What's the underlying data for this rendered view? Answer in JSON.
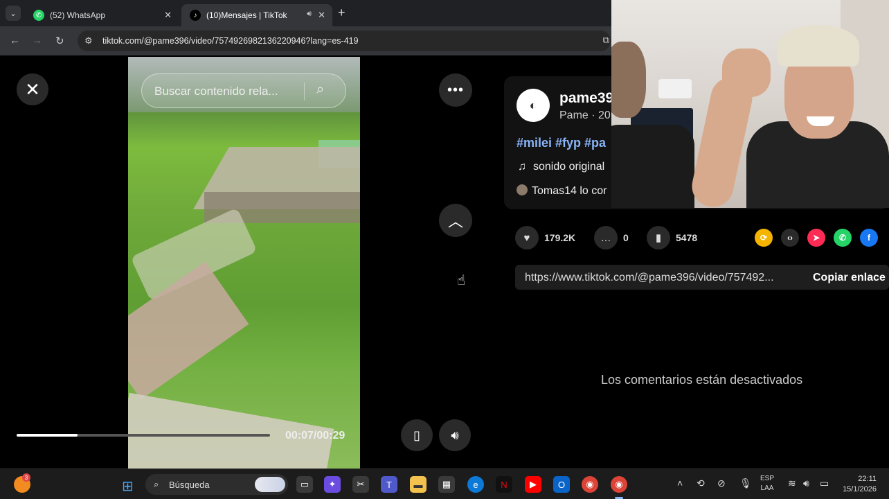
{
  "browser": {
    "tabs": [
      {
        "label": "(52) WhatsApp",
        "icon": "whatsapp-icon",
        "active": false
      },
      {
        "label": "(10)Mensajes | TikTok",
        "icon": "tiktok-icon",
        "active": true
      }
    ],
    "url": "tiktok.com/@pame396/video/7574926982136220946?lang=es-419"
  },
  "video": {
    "search_placeholder": "Buscar contenido rela...",
    "time": "00:07/00:29",
    "progress": 0.24
  },
  "post": {
    "author": "pame39",
    "author_sub": "Pame · 20",
    "hashtags": "#milei #fyp #pa",
    "music": "sonido original",
    "liked_by": "Tomas14 lo cor",
    "likes": "179.2K",
    "comments": "0",
    "saves": "5478",
    "link": "https://www.tiktok.com/@pame396/video/757492...",
    "copy_label": "Copiar enlace",
    "comments_disabled": "Los comentarios están desactivados"
  },
  "share_colors": {
    "repost": "#f5b400",
    "embed": "#2a2a2a",
    "direct": "#fe2c55",
    "whatsapp": "#25d366",
    "facebook": "#1877f2"
  },
  "taskbar": {
    "search_label": "Búsqueda",
    "widget_badge": "3",
    "lang_top": "ESP",
    "lang_bottom": "LAA",
    "time": "22:11",
    "date": "15/1/2026"
  }
}
